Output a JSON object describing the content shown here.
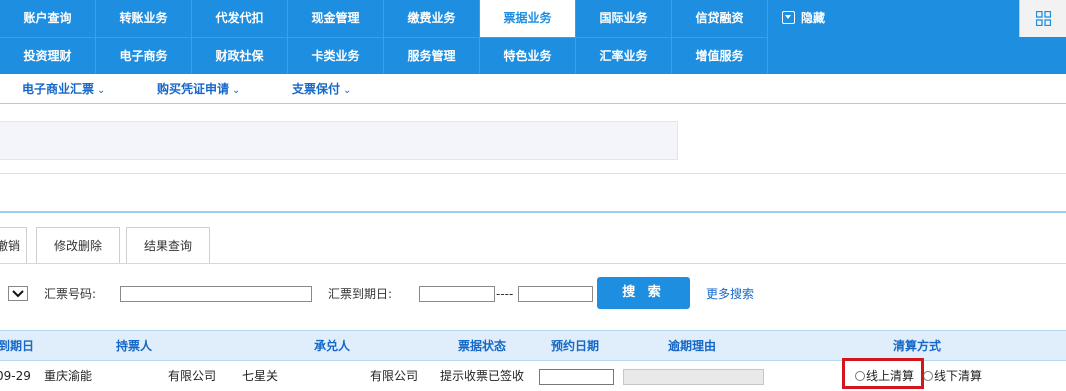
{
  "nav": {
    "row1": [
      "账户查询",
      "转账业务",
      "代发代扣",
      "现金管理",
      "缴费业务",
      "票据业务",
      "国际业务",
      "信贷融资"
    ],
    "row2": [
      "投资理财",
      "电子商务",
      "财政社保",
      "卡类业务",
      "服务管理",
      "特色业务",
      "汇率业务",
      "增值服务"
    ],
    "active": "票据业务",
    "hide_label": "隐藏"
  },
  "subnav": {
    "items": [
      "电子商业汇票",
      "购买凭证申请",
      "支票保付"
    ],
    "caret": "⌄"
  },
  "tabs": [
    "撤销",
    "修改删除",
    "结果查询"
  ],
  "search": {
    "bill_no_label": "汇票号码:",
    "bill_no_value": "",
    "due_date_label": "汇票到期日:",
    "due_from": "",
    "range_sep": "----",
    "due_to": "",
    "search_button": "搜 索",
    "more_search": "更多搜索"
  },
  "table": {
    "columns": [
      "到期日",
      "持票人",
      "承兑人",
      "票据状态",
      "预约日期",
      "逾期理由",
      "清算方式"
    ],
    "rows": [
      {
        "due_date": "09-29",
        "holder_prefix": "重庆渝能",
        "holder_suffix": "有限公司",
        "acceptor_prefix": "七星关",
        "acceptor_suffix": "有限公司",
        "status": "提示收票已签收",
        "appointment_date": "",
        "overdue_reason": "",
        "settlement_online": "线上清算",
        "settlement_offline": "线下清算"
      }
    ]
  },
  "colors": {
    "nav_blue": "#1e8fe0",
    "link_blue": "#1668c8",
    "header_bg": "#dfeefa",
    "highlight_red": "#d2161c"
  }
}
